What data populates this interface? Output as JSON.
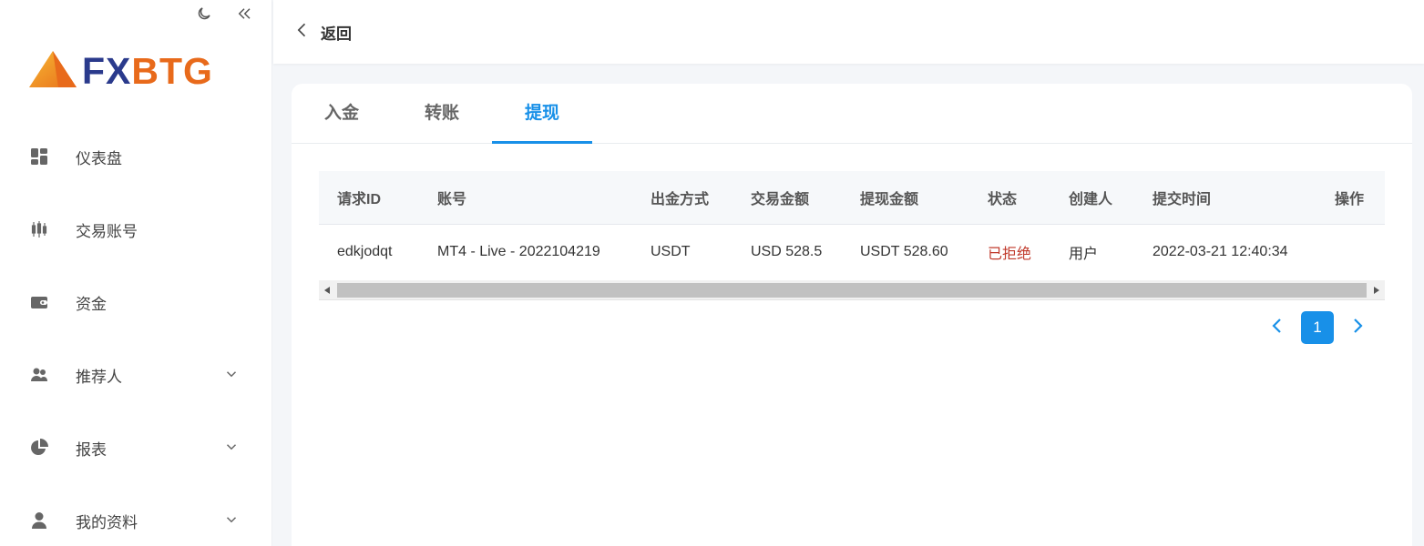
{
  "brand": {
    "fx": "FX",
    "btg": "BTG",
    "accent": "#1890e8",
    "orange": "#e86a1b",
    "navy": "#2a3a8c"
  },
  "sidebar_tools": {
    "theme_icon": "moon-icon",
    "collapse_icon": "double-chevron-left-icon"
  },
  "sidebar": {
    "items": [
      {
        "label": "仪表盘",
        "icon": "dashboard-icon"
      },
      {
        "label": "交易账号",
        "icon": "candlestick-icon"
      },
      {
        "label": "资金",
        "icon": "wallet-icon"
      },
      {
        "label": "推荐人",
        "icon": "users-icon",
        "expandable": true
      },
      {
        "label": "报表",
        "icon": "pie-chart-icon",
        "expandable": true
      },
      {
        "label": "我的资料",
        "icon": "user-icon",
        "expandable": true
      }
    ]
  },
  "header": {
    "back_label": "返回"
  },
  "tabs": [
    {
      "label": "入金"
    },
    {
      "label": "转账"
    },
    {
      "label": "提现",
      "active": true
    }
  ],
  "table": {
    "columns": [
      "请求ID",
      "账号",
      "出金方式",
      "交易金额",
      "提现金额",
      "状态",
      "创建人",
      "提交时间",
      "操作"
    ],
    "rows": [
      {
        "id": "edkjodqt",
        "account": "MT4 - Live - 2022104219",
        "method": "USDT",
        "trade_amount": "USD 528.5",
        "withdraw_amount": "USDT 528.60",
        "status": "已拒绝",
        "creator": "用户",
        "submitted": "2022-03-21 12:40:34",
        "action": ""
      }
    ]
  },
  "pagination": {
    "current": "1"
  }
}
